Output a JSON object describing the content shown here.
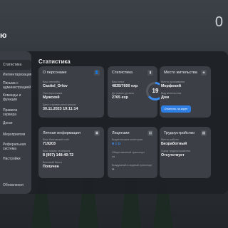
{
  "brand_fragment": "ю",
  "top_right": "0",
  "sidebar": {
    "items": [
      {
        "label": "Статистика",
        "active": true
      },
      {
        "label": "Ингвентаризация"
      },
      {
        "label": "Письма с администрацией"
      },
      {
        "label": "Команды и функции"
      },
      {
        "label": "Правила сервера"
      },
      {
        "label": "Донат"
      },
      {
        "label": "Мероприятия"
      },
      {
        "label": "Реферальная система"
      },
      {
        "label": "Настройки"
      },
      {
        "label": "Обновления"
      }
    ]
  },
  "main": {
    "title": "Статистика"
  },
  "cards": {
    "about": {
      "title": "О персонаже",
      "nick_label": "Ваш никнейм",
      "nick_value": "Castiel_Orlov",
      "sex_label": "Пол персонажа",
      "sex_value": "Мужской",
      "reg_label": "Дата и время регистрации",
      "reg_value": "30.11.2023 19:11:14"
    },
    "stats": {
      "title": "Статистика",
      "exp_label": "Ваш опыт",
      "exp_value": "4835/7600 exp",
      "next_label": "До нового уровня",
      "next_value": "2765 exp",
      "level": "19",
      "progress": 0.64
    },
    "residence": {
      "title": "Место жительства",
      "place_label": "Место проживания",
      "place_value": "Мерфокий",
      "type_label": "Вид жительства",
      "type_value": "Дом",
      "button": "Отметить на карте"
    },
    "personal": {
      "title": "Личная информация",
      "bank_label": "Ваш банковский счёт",
      "bank_value": "719203",
      "phone_label": "Ваш номер телефона",
      "phone_value": "8 (997) 148-40-72",
      "military_label": "Военный билет",
      "military_value": "Получен"
    },
    "licenses": {
      "title": "Лицензии",
      "cats_label": "Водительские категории",
      "cats_value": "B  C  D",
      "transport_label": "Общественный транспорт",
      "air_label": "Воздушный и водный транспорт"
    },
    "job": {
      "title": "Трудоустройство",
      "work_label": "Место работы",
      "work_value": "Безработный",
      "fraction_label": "Город трудоустройства",
      "fraction_value": "Отсутствует"
    }
  },
  "icons": {
    "card_icon": "user-icon"
  }
}
